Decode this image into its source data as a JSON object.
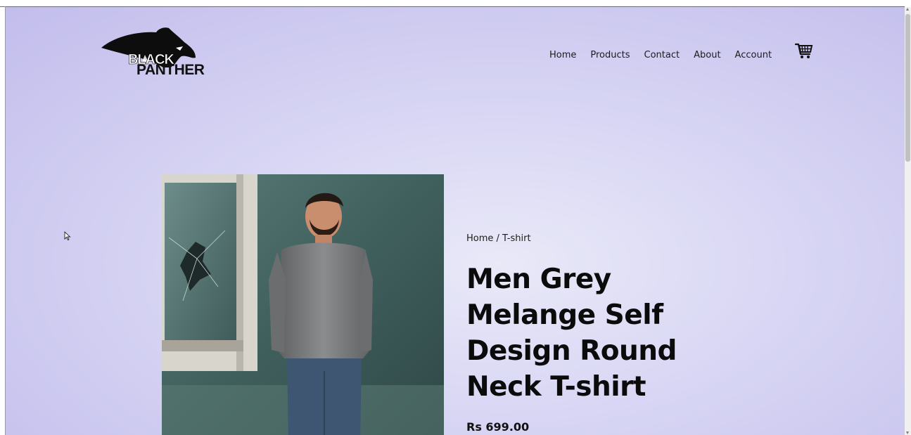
{
  "brand": {
    "logo_line1": "BLACK",
    "logo_line2": "PANTHER"
  },
  "nav": {
    "items": [
      "Home",
      "Products",
      "Contact",
      "About",
      "Account"
    ],
    "cart_icon": "shopping-cart-icon"
  },
  "product": {
    "breadcrumb": "Home / T-shirt",
    "title": "Men Grey Melange Self Design Round Neck T-shirt",
    "price": "Rs 699.00"
  },
  "colors": {
    "background_center": "#e9e9f8",
    "background_edge": "#c2bdec",
    "text": "#0b0b0b"
  }
}
